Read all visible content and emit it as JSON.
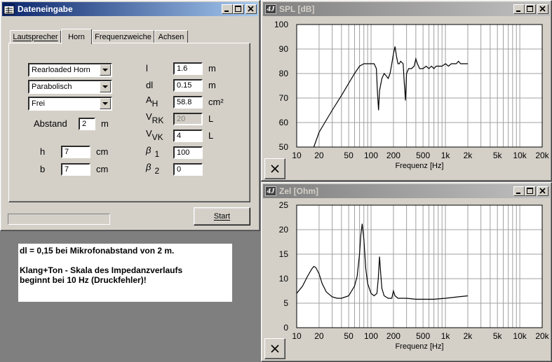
{
  "dialog": {
    "title": "Dateneingabe",
    "tabs": [
      {
        "label": "Lautsprecher",
        "selected": false
      },
      {
        "label": "Horn",
        "selected": true
      },
      {
        "label": "Frequenzweiche",
        "selected": false
      },
      {
        "label": "Achsen",
        "selected": false
      }
    ],
    "combos": [
      "Rearloaded Horn",
      "Parabolisch",
      "Frei"
    ],
    "abstand": {
      "label": "Abstand",
      "value": "2",
      "unit": "m"
    },
    "h": {
      "label": "h",
      "value": "7",
      "unit": "cm"
    },
    "b": {
      "label": "b",
      "value": "7",
      "unit": "cm"
    },
    "params": [
      {
        "sym": "l",
        "sub": "",
        "value": "1.6",
        "unit": "m",
        "disabled": false
      },
      {
        "sym": "dl",
        "sub": "",
        "value": "0.15",
        "unit": "m",
        "disabled": false
      },
      {
        "sym": "A",
        "sub": "H",
        "value": "58.8",
        "unit": "cm²",
        "disabled": false
      },
      {
        "sym": "V",
        "sub": "RK",
        "value": "20",
        "unit": "L",
        "disabled": true
      },
      {
        "sym": "V",
        "sub": "VK",
        "value": "4",
        "unit": "L",
        "disabled": false
      },
      {
        "sym": "β",
        "sub": "1",
        "value": "100",
        "unit": "",
        "disabled": false
      },
      {
        "sym": "β",
        "sub": "2",
        "value": "0",
        "unit": "",
        "disabled": false
      }
    ],
    "start_label": "Start"
  },
  "note": {
    "lines": [
      "dl = 0,15 bei Mikrofonabstand von 2 m.",
      "",
      "Klang+Ton - Skala des Impedanzverlaufs",
      "beginnt bei 10 Hz (Druckfehler)!"
    ]
  },
  "logo_text": "4J",
  "chart_data": [
    {
      "type": "line",
      "title": "SPL [dB]",
      "xlabel": "Frequenz [Hz]",
      "ylabel": "",
      "xscale": "log",
      "xlim": [
        10,
        20000
      ],
      "ylim": [
        50,
        100
      ],
      "yticks": [
        50,
        60,
        70,
        80,
        90,
        100
      ],
      "xtick_labels": [
        {
          "v": 10,
          "t": "10"
        },
        {
          "v": 20,
          "t": "20"
        },
        {
          "v": 50,
          "t": "50"
        },
        {
          "v": 100,
          "t": "100"
        },
        {
          "v": 200,
          "t": "200"
        },
        {
          "v": 500,
          "t": "500"
        },
        {
          "v": 1000,
          "t": "1k"
        },
        {
          "v": 2000,
          "t": "2k"
        },
        {
          "v": 5000,
          "t": "5k"
        },
        {
          "v": 10000,
          "t": "10k"
        },
        {
          "v": 20000,
          "t": "20k"
        }
      ],
      "grid": true,
      "series": [
        {
          "x": [
            17,
            20,
            25,
            30,
            40,
            50,
            60,
            70,
            80,
            90,
            100,
            110,
            118,
            122,
            126,
            130,
            140,
            150,
            160,
            170,
            180,
            190,
            200,
            210,
            220,
            230,
            240,
            250,
            270,
            280,
            290,
            300,
            320,
            350,
            380,
            400,
            420,
            450,
            480,
            500,
            550,
            600,
            650,
            700,
            750,
            800,
            900,
            1000,
            1100,
            1200,
            1300,
            1400,
            1500,
            1600,
            1700,
            1800,
            1900,
            2000
          ],
          "y": [
            50,
            56,
            61,
            65,
            71,
            76,
            80,
            83,
            84,
            84,
            84,
            84,
            82,
            72,
            65,
            73,
            78,
            80,
            79,
            78,
            80,
            84,
            88,
            91,
            87,
            84,
            84,
            85,
            84,
            76,
            69,
            80,
            82,
            82,
            83,
            86,
            84,
            82,
            82,
            82,
            83,
            82,
            83,
            82,
            83,
            83,
            83,
            84,
            83,
            84,
            84,
            84,
            85,
            84,
            84,
            84,
            84,
            84
          ]
        }
      ]
    },
    {
      "type": "line",
      "title": "Zel [Ohm]",
      "xlabel": "Frequenz [Hz]",
      "ylabel": "",
      "xscale": "log",
      "xlim": [
        10,
        20000
      ],
      "ylim": [
        0,
        25
      ],
      "yticks": [
        0,
        5,
        10,
        15,
        20,
        25
      ],
      "xtick_labels": [
        {
          "v": 10,
          "t": "10"
        },
        {
          "v": 20,
          "t": "20"
        },
        {
          "v": 50,
          "t": "50"
        },
        {
          "v": 100,
          "t": "100"
        },
        {
          "v": 200,
          "t": "200"
        },
        {
          "v": 500,
          "t": "500"
        },
        {
          "v": 1000,
          "t": "1k"
        },
        {
          "v": 2000,
          "t": "2k"
        },
        {
          "v": 5000,
          "t": "5k"
        },
        {
          "v": 10000,
          "t": "10k"
        },
        {
          "v": 20000,
          "t": "20k"
        }
      ],
      "grid": true,
      "series": [
        {
          "x": [
            10,
            12,
            14,
            16,
            17,
            18,
            20,
            22,
            25,
            30,
            35,
            40,
            50,
            60,
            65,
            70,
            73,
            76,
            80,
            85,
            90,
            100,
            110,
            120,
            125,
            130,
            135,
            140,
            150,
            170,
            190,
            200,
            210,
            230,
            300,
            400,
            500,
            700,
            1000,
            1500,
            2000
          ],
          "y": [
            7,
            8.5,
            10.5,
            12,
            12.5,
            12.3,
            11,
            9,
            7.3,
            6.3,
            6,
            6,
            6.5,
            8.5,
            10.5,
            15,
            19,
            21.2,
            18,
            12,
            9,
            7,
            6.5,
            7,
            10,
            14.5,
            11,
            8,
            6.5,
            6,
            6,
            7.5,
            6.5,
            6,
            6,
            5.8,
            5.8,
            5.8,
            6,
            6.3,
            6.5
          ]
        }
      ]
    }
  ]
}
